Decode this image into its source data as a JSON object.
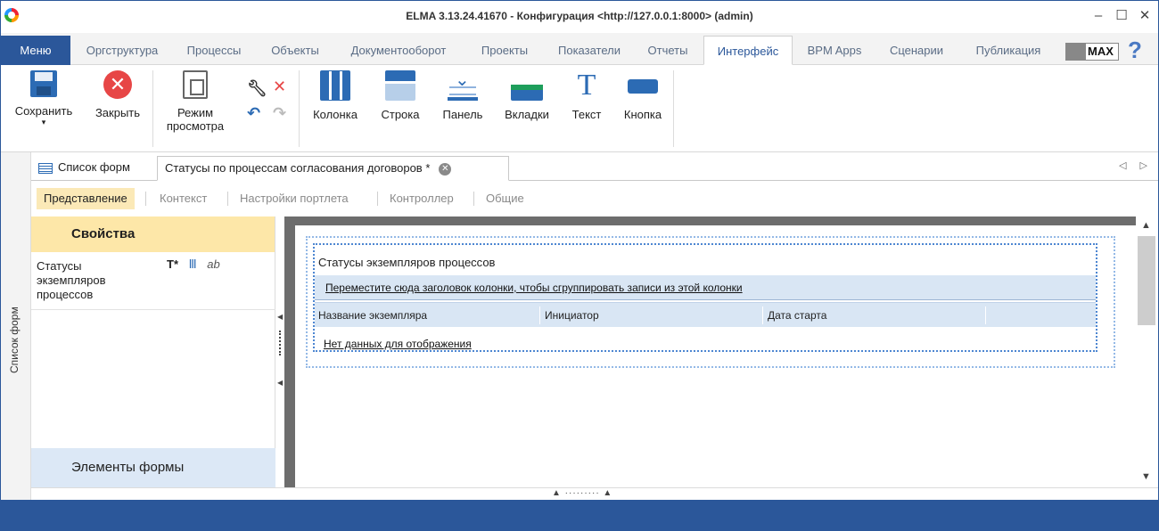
{
  "window": {
    "title": "ELMA 3.13.24.41670 - Конфигурация <http://127.0.0.1:8000> (admin)",
    "controls": {
      "minimize": "–",
      "maximize": "☐",
      "close": "✕"
    }
  },
  "menubar": {
    "menu_label": "Меню",
    "tabs": [
      {
        "label": "Оргструктура"
      },
      {
        "label": "Процессы"
      },
      {
        "label": "Объекты"
      },
      {
        "label": "Документооборот"
      },
      {
        "label": "Проекты"
      },
      {
        "label": "Показатели"
      },
      {
        "label": "Отчеты"
      },
      {
        "label": "Интерфейс",
        "active": true
      },
      {
        "label": "BPM Apps"
      },
      {
        "label": "Сценарии"
      },
      {
        "label": "Публикация"
      }
    ],
    "max_badge": "MAX",
    "help": "?"
  },
  "ribbon": {
    "save": "Сохранить",
    "save_arrow": "▾",
    "close": "Закрыть",
    "view_mode_line1": "Режим",
    "view_mode_line2": "просмотра",
    "column": "Колонка",
    "row": "Строка",
    "panel": "Панель",
    "tabs": "Вкладки",
    "text": "Текст",
    "button": "Кнопка",
    "text_icon_glyph": "T",
    "close_icon_glyph": "✕"
  },
  "sidebar_strip": {
    "label": "Список форм"
  },
  "doc_tabs": {
    "list_tab": "Список форм",
    "active_tab": "Статусы по процессам согласования договоров *",
    "close_glyph": "✕",
    "scroll": "◁ ▷"
  },
  "sub_tabs": [
    "Представление",
    "Контекст",
    "Настройки портлета",
    "Контроллер",
    "Общие"
  ],
  "properties": {
    "header": "Свойства",
    "item_label": "Статусы экземпляров процессов",
    "icon_text": "T*",
    "icon_cols": "Ⅲ",
    "icon_ab": "ab",
    "footer": "Элементы формы"
  },
  "grid": {
    "title": "Статусы экземпляров процессов",
    "group_hint": "Переместите сюда заголовок колонки, чтобы сгруппировать записи из этой колонки",
    "columns": [
      "Название экземпляра",
      "Инициатор",
      "Дата старта"
    ],
    "empty_text": "Нет данных для отображения"
  },
  "colors": {
    "accent": "#2b579a",
    "properties_header": "#fde7a8",
    "active_subtab": "#fbe9b7",
    "grid_header": "#d9e6f4",
    "canvas_border": "#6d6d6d"
  }
}
